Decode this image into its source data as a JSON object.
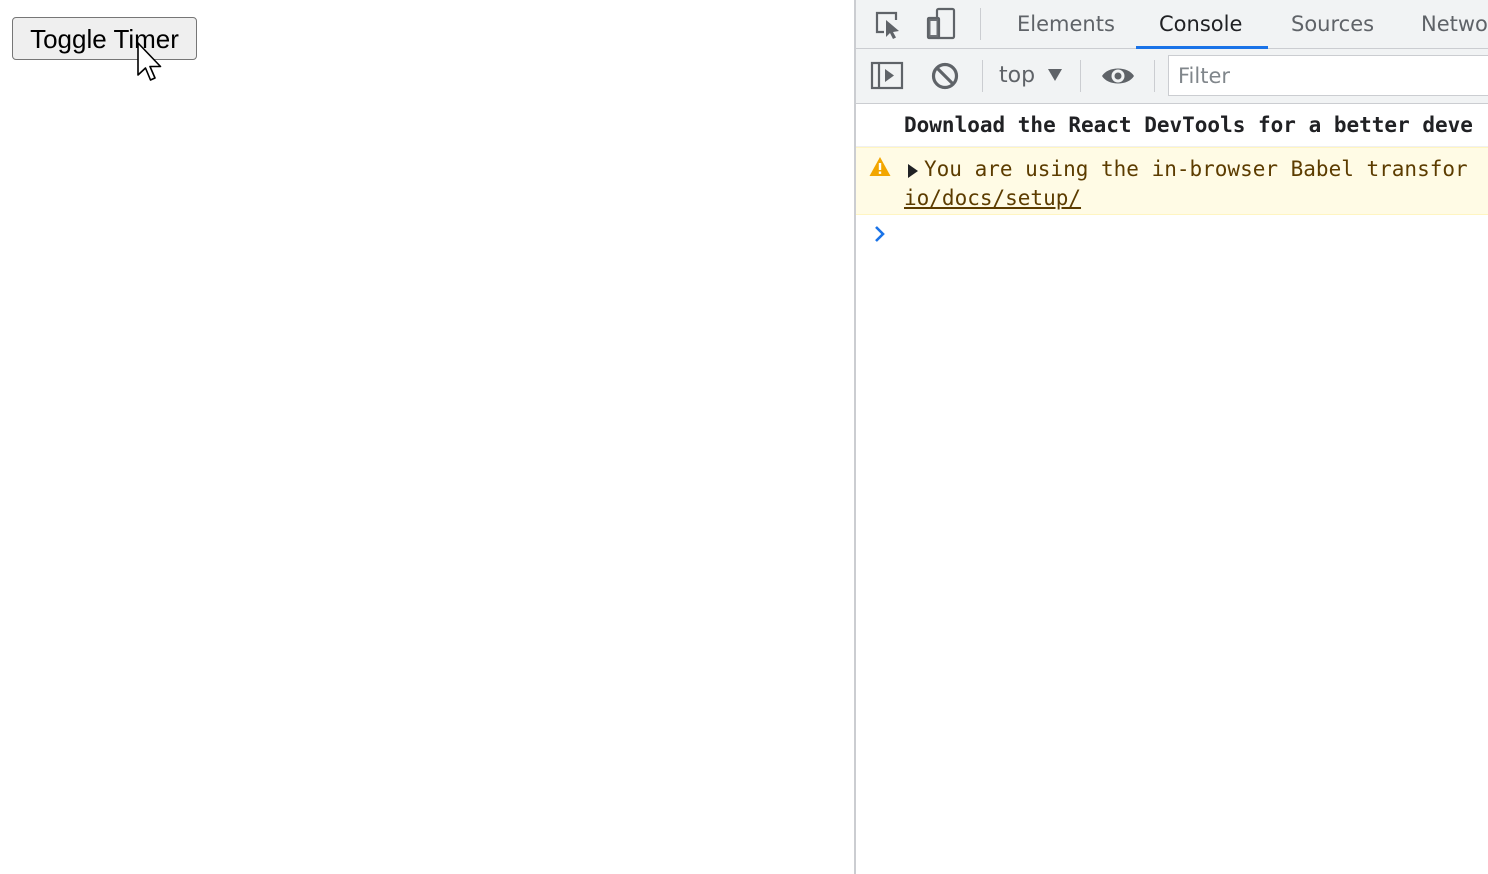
{
  "page": {
    "toggle_button_label": "Toggle Timer"
  },
  "devtools": {
    "tabs": [
      {
        "label": "Elements",
        "active": false
      },
      {
        "label": "Console",
        "active": true
      },
      {
        "label": "Sources",
        "active": false
      },
      {
        "label": "Netwo",
        "active": false
      }
    ],
    "toolbar": {
      "context": "top",
      "filter_placeholder": "Filter",
      "filter_value": ""
    },
    "console": {
      "messages": [
        {
          "level": "info",
          "text": "Download the React DevTools for a better deve"
        },
        {
          "level": "warning",
          "line1": "You are using the in-browser Babel transfor",
          "link": "io/docs/setup/"
        }
      ]
    },
    "icons": {
      "inspect": "element-picker-icon",
      "device": "device-toolbar-icon",
      "sidebar": "console-sidebar-icon",
      "clear": "clear-console-icon",
      "eye": "live-expression-icon",
      "warning": "warning-icon",
      "prompt": "prompt-chevron-icon"
    },
    "colors": {
      "accent": "#1a73e8",
      "warning_bg": "#fffbe5",
      "warning_text": "#5c3c00",
      "warning_icon": "#f2a600",
      "prompt": "#1a73e8"
    }
  }
}
